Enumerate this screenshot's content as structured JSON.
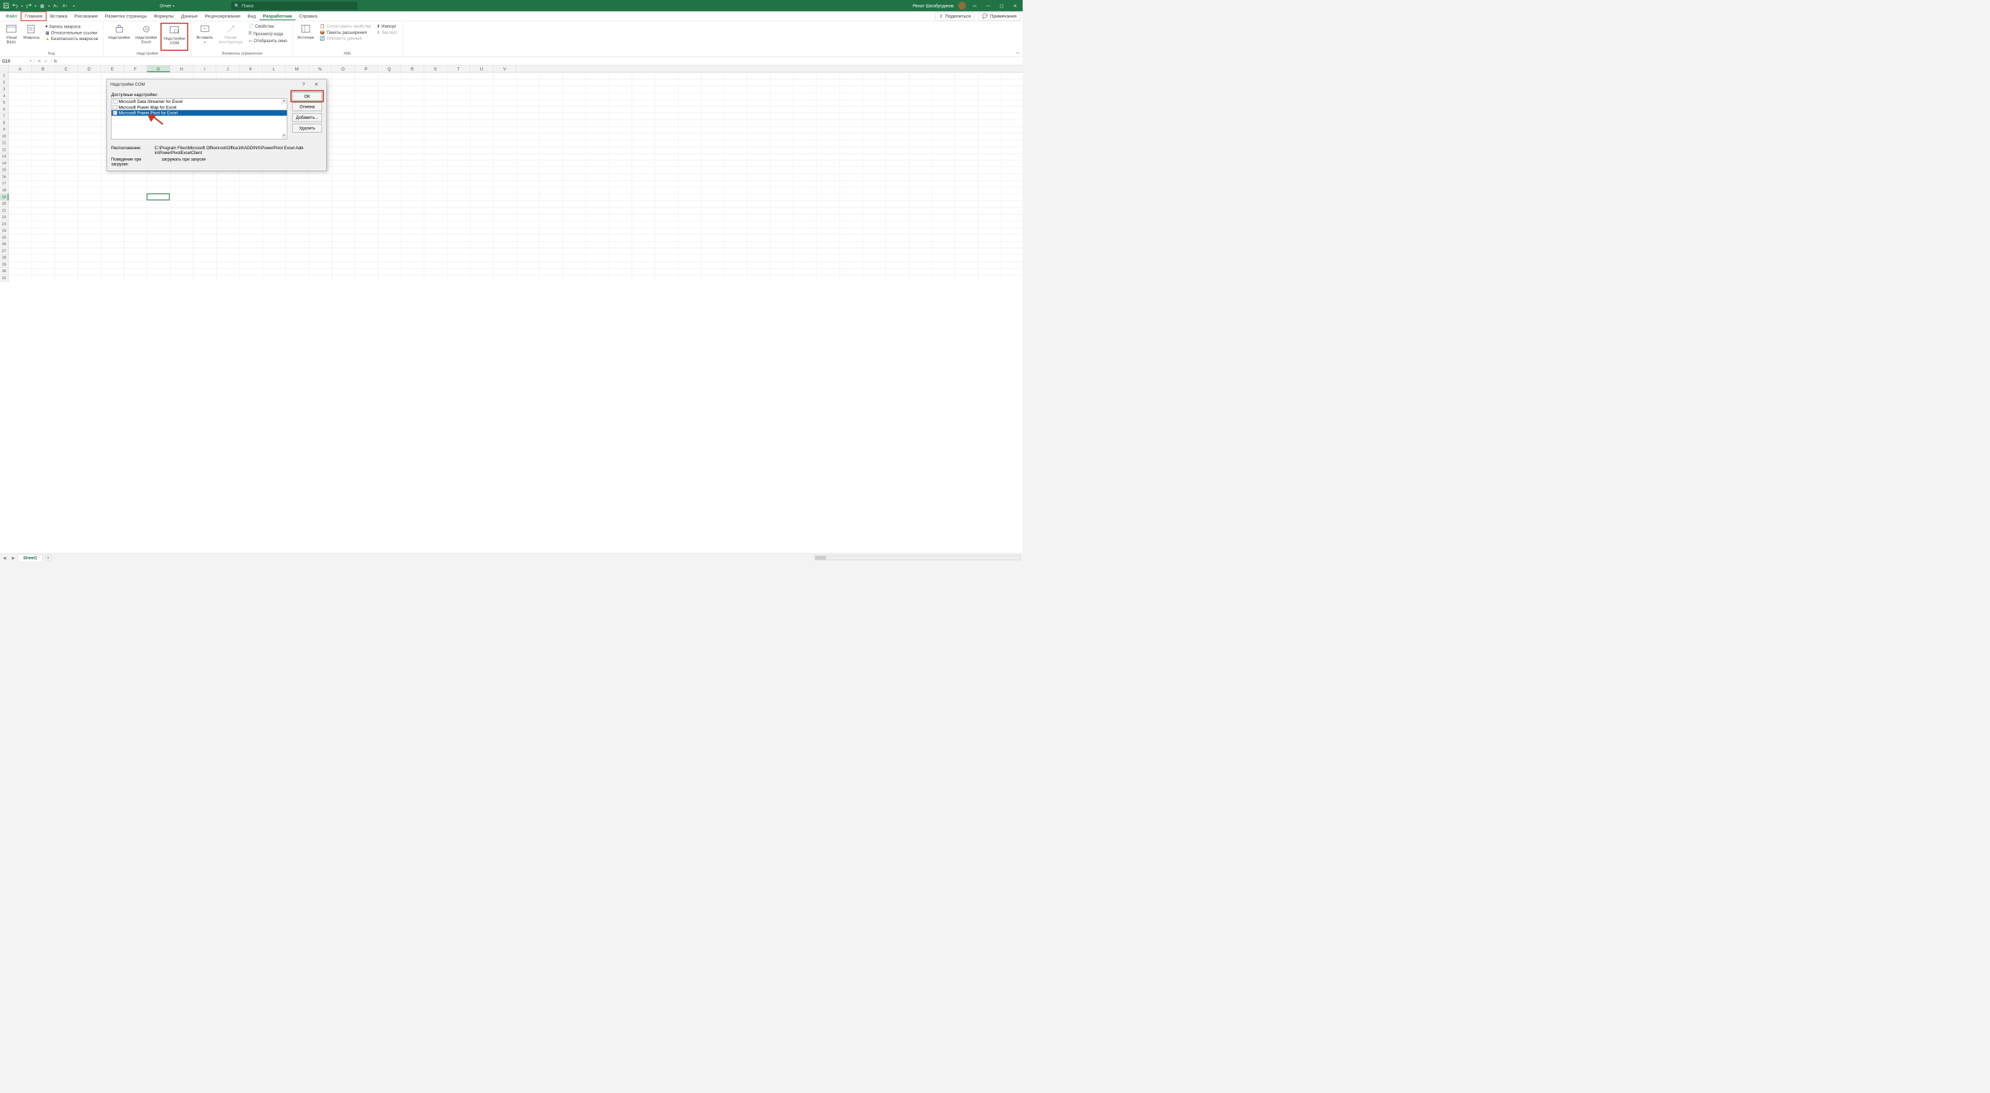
{
  "titlebar": {
    "doc_name": "Отчет",
    "search_placeholder": "Поиск",
    "user_name": "Ренат Шагабутдинов"
  },
  "tabs": {
    "file": "Файл",
    "home": "Главная",
    "insert": "Вставка",
    "draw": "Рисование",
    "layout": "Разметка страницы",
    "formulas": "Формулы",
    "data": "Данные",
    "review": "Рецензирование",
    "view": "Вид",
    "developer": "Разработчик",
    "help": "Справка",
    "share": "Поделиться",
    "comments": "Примечания"
  },
  "ribbon": {
    "code": {
      "visual_basic": "Visual\nBasic",
      "macros": "Макросы",
      "record_macro": "Запись макроса",
      "relative_refs": "Относительные ссылки",
      "macro_security": "Безопасность макросов",
      "group": "Код"
    },
    "addins": {
      "addins": "Надстройки",
      "excel_addins": "Надстройки\nExcel",
      "com_addins": "Надстройки\nCOM",
      "group": "Надстройки"
    },
    "controls": {
      "insert": "Вставить",
      "design_mode": "Режим\nконструктора",
      "properties": "Свойства",
      "view_code": "Просмотр кода",
      "run_dialog": "Отобразить окно",
      "group": "Элементы управления"
    },
    "xml": {
      "source": "Источник",
      "map_props": "Сопоставить свойства",
      "expansion": "Пакеты расширения",
      "refresh": "Обновить данные",
      "import": "Импорт",
      "export": "Экспорт",
      "group": "XML"
    }
  },
  "namebox": "G19",
  "columns": [
    "A",
    "B",
    "C",
    "D",
    "E",
    "F",
    "G",
    "H",
    "I",
    "J",
    "K",
    "L",
    "M",
    "N",
    "O",
    "P",
    "Q",
    "R",
    "S",
    "T",
    "U",
    "V"
  ],
  "rows": 31,
  "selected": {
    "col_index": 6,
    "row_index": 18
  },
  "dialog": {
    "title": "Надстройки COM",
    "available_label": "Доступные надстройки:",
    "items": [
      {
        "label": "Microsoft Data Streamer for Excel",
        "checked": false,
        "selected": false
      },
      {
        "label": "Microsoft Power Map for Excel",
        "checked": false,
        "selected": false
      },
      {
        "label": "Microsoft Power Pivot for Excel",
        "checked": true,
        "selected": true
      }
    ],
    "ok": "OK",
    "cancel": "Отмена",
    "add": "Добавить...",
    "remove": "Удалить",
    "location_label": "Расположение:",
    "location_value": "C:\\Program Files\\Microsoft Office\\root\\Office16\\ADDINS\\PowerPivot Excel Add-in\\PowerPivotExcelClient",
    "behavior_label": "Поведение при загрузке:",
    "behavior_value": "загружать при запуске"
  },
  "sheet": {
    "name": "Sheet1"
  }
}
